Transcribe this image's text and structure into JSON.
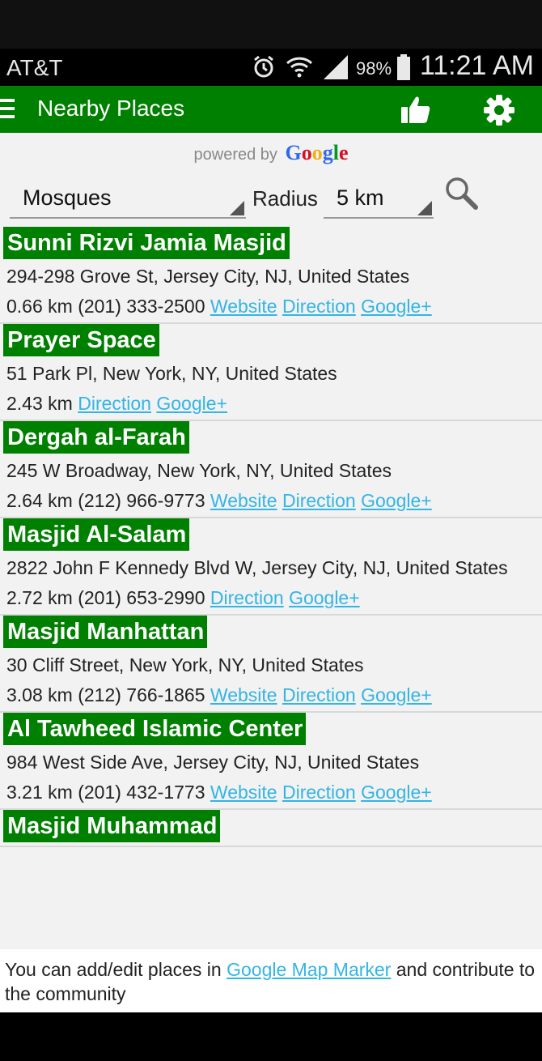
{
  "status_bar": {
    "carrier": "AT&T",
    "battery_percent": "98%",
    "time": "11:21 AM",
    "icons": [
      "alarm-icon",
      "wifi-icon",
      "signal-icon",
      "battery-icon"
    ]
  },
  "app_bar": {
    "title": "Nearby Places",
    "icons": [
      "menu-icon",
      "thumbs-up-icon",
      "gear-icon"
    ]
  },
  "powered_by": {
    "prefix": "powered by",
    "brand": "Google"
  },
  "filters": {
    "category": "Mosques",
    "radius_label": "Radius",
    "radius_value": "5 km"
  },
  "links": {
    "website": "Website",
    "direction": "Direction",
    "google_plus": "Google+"
  },
  "places": [
    {
      "name": "Sunni Rizvi Jamia Masjid",
      "address": "294-298 Grove St, Jersey City, NJ, United States",
      "distance": "0.66 km",
      "phone": "(201) 333-2500"
    },
    {
      "name": "Prayer Space",
      "address": "51 Park Pl, New York, NY, United States",
      "distance": "2.43 km",
      "phone": ""
    },
    {
      "name": "Dergah al-Farah",
      "address": "245 W Broadway, New York, NY, United States",
      "distance": "2.64 km",
      "phone": "(212) 966-9773"
    },
    {
      "name": "Masjid Al-Salam",
      "address": "2822 John F Kennedy Blvd W, Jersey City, NJ, United States",
      "distance": "2.72 km",
      "phone": "(201) 653-2990"
    },
    {
      "name": "Masjid Manhattan",
      "address": "30 Cliff Street, New York, NY, United States",
      "distance": "3.08 km",
      "phone": "(212) 766-1865"
    },
    {
      "name": "Al Tawheed Islamic Center",
      "address": "984 West Side Ave, Jersey City, NJ, United States",
      "distance": "3.21 km",
      "phone": "(201) 432-1773"
    },
    {
      "name": "Masjid Muhammad",
      "address": "",
      "distance": "",
      "phone": ""
    }
  ],
  "footer": {
    "prefix": "You can add/edit places in",
    "link": "Google Map Marker",
    "suffix": "and contribute to the community"
  },
  "colors": {
    "accent_green": "#008000",
    "link_blue": "#33b5e5"
  }
}
